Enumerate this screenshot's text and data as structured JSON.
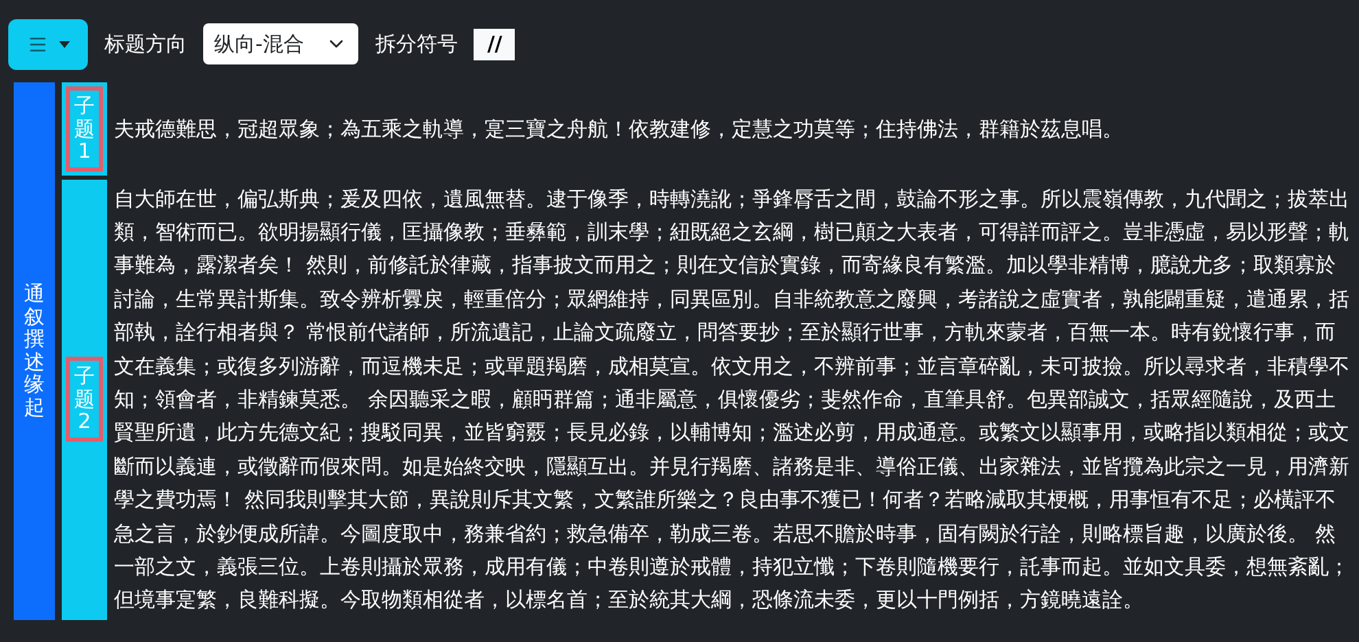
{
  "toolbar": {
    "title_direction_label": "标题方向",
    "title_direction_value": "纵向-混合",
    "split_symbol_label": "拆分符号",
    "split_symbol_value": "//"
  },
  "sections": [
    {
      "title": "通叙撰述缘起",
      "subsections": [
        {
          "title": "子题1",
          "text": "夫戒德難思，冠超眾象；為五乘之軌導，寔三寶之舟航！依教建修，定慧之功莫等；住持佛法，群籍於茲息唱。"
        },
        {
          "title": "子题2",
          "text": "自大師在世，偏弘斯典；爰及四依，遺風無替。逮于像季，時轉澆訛；爭鋒脣舌之間，鼓論不形之事。所以震嶺傳教，九代聞之；拔萃出類，智術而已。欲明揚顯行儀，匡攝像教；垂彝範，訓末學；紐既絕之玄綱，樹已顛之大表者，可得詳而評之。豈非憑虛，易以形聲；軌事難為，露潔者矣！ 然則，前修託於律藏，指事披文而用之；則在文信於實錄，而寄緣良有繁濫。加以學非精博，臆說尤多；取類寡於討論，生常異計斯集。致令辨析釁戾，輕重倍分；眾網維持，同異區別。自非統教意之廢興，考諸說之虛實者，孰能闢重疑，遣通累，括部執，詮行相者與？ 常恨前代諸師，所流遺記，止論文疏廢立，問答要抄；至於顯行世事，方軌來蒙者，百無一本。時有銳懷行事，而文在義集；或復多列游辭，而逗機未足；或單題羯磨，成相莫宣。依文用之，不辨前事；並言章碎亂，未可披撿。所以尋求者，非積學不知；領會者，非精鍊莫悉。 余因聽采之暇，顧眄群篇；通非屬意，俱懷優劣；斐然作命，直筆具舒。包異部誠文，括眾經隨說，及西土賢聖所遺，此方先德文紀；搜駁同異，並皆窮覈；長見必錄，以輔博知；濫述必剪，用成通意。或繁文以顯事用，或略指以類相從；或文斷而以義連，或徵辭而假來問。如是始終交映，隱顯互出。并見行羯磨、諸務是非、導俗正儀、出家雜法，並皆攬為此宗之一見，用濟新學之費功焉！ 然同我則擊其大節，異說則斥其文繁，文繁誰所樂之？良由事不獲已！何者？若略減取其梗概，用事恒有不足；必橫評不急之言，於鈔便成所諱。今圖度取中，務兼省約；救急備卒，勒成三卷。若思不贍於時事，固有闕於行詮，則略標旨趣，以廣於後。 然一部之文，義張三位。上卷則攝於眾務，成用有儀；中卷則遵於戒體，持犯立懺；下卷則隨機要行，託事而起。並如文具委，想無紊亂；但境事寔繁，良難科擬。今取物類相從者，以標名首；至於統其大綱，恐條流未委，更以十門例括，方鏡曉遠詮。"
        }
      ]
    }
  ]
}
